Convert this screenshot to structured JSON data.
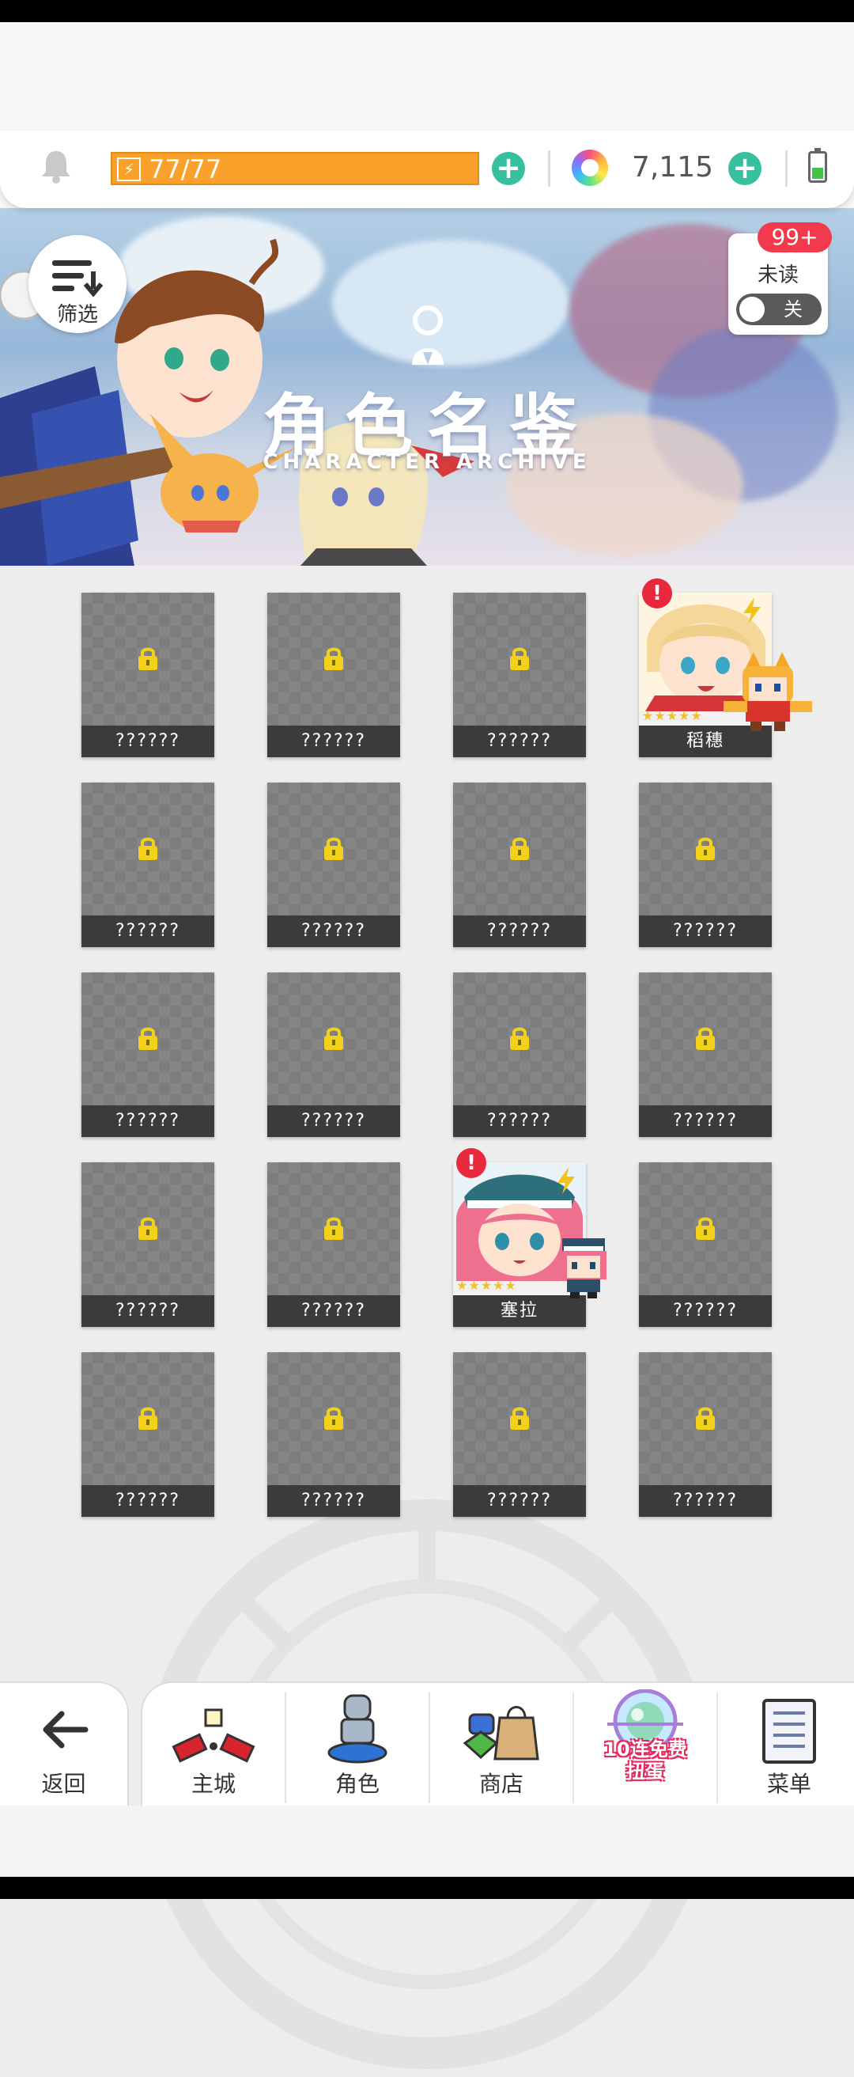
{
  "resource_bar": {
    "energy": "77/77",
    "gems": "7,115"
  },
  "banner": {
    "filter_label": "筛选",
    "title": "角色名鉴",
    "subtitle": "CHARACTER ARCHIVE",
    "unread_count": "99+",
    "unread_label": "未读",
    "unread_toggle": "关"
  },
  "characters": [
    {
      "name": "??????",
      "locked": true
    },
    {
      "name": "??????",
      "locked": true
    },
    {
      "name": "??????",
      "locked": true
    },
    {
      "name": "稻穗",
      "locked": false,
      "stars": 5
    },
    {
      "name": "??????",
      "locked": true
    },
    {
      "name": "??????",
      "locked": true
    },
    {
      "name": "??????",
      "locked": true
    },
    {
      "name": "??????",
      "locked": true
    },
    {
      "name": "??????",
      "locked": true
    },
    {
      "name": "??????",
      "locked": true
    },
    {
      "name": "??????",
      "locked": true
    },
    {
      "name": "??????",
      "locked": true
    },
    {
      "name": "??????",
      "locked": true
    },
    {
      "name": "??????",
      "locked": true
    },
    {
      "name": "塞拉",
      "locked": false,
      "stars": 5
    },
    {
      "name": "??????",
      "locked": true
    },
    {
      "name": "??????",
      "locked": true
    },
    {
      "name": "??????",
      "locked": true
    },
    {
      "name": "??????",
      "locked": true
    },
    {
      "name": "??????",
      "locked": true
    }
  ],
  "nav": {
    "back": "返回",
    "home": "主城",
    "character": "角色",
    "shop": "商店",
    "gacha_line1": "10连免费",
    "gacha_line2": "扭蛋",
    "menu": "菜单"
  },
  "colors": {
    "energy_fill": "#f9a12b",
    "plus_button": "#36c0a0",
    "alert_red": "#e8283c",
    "card_locked": "#858585"
  }
}
